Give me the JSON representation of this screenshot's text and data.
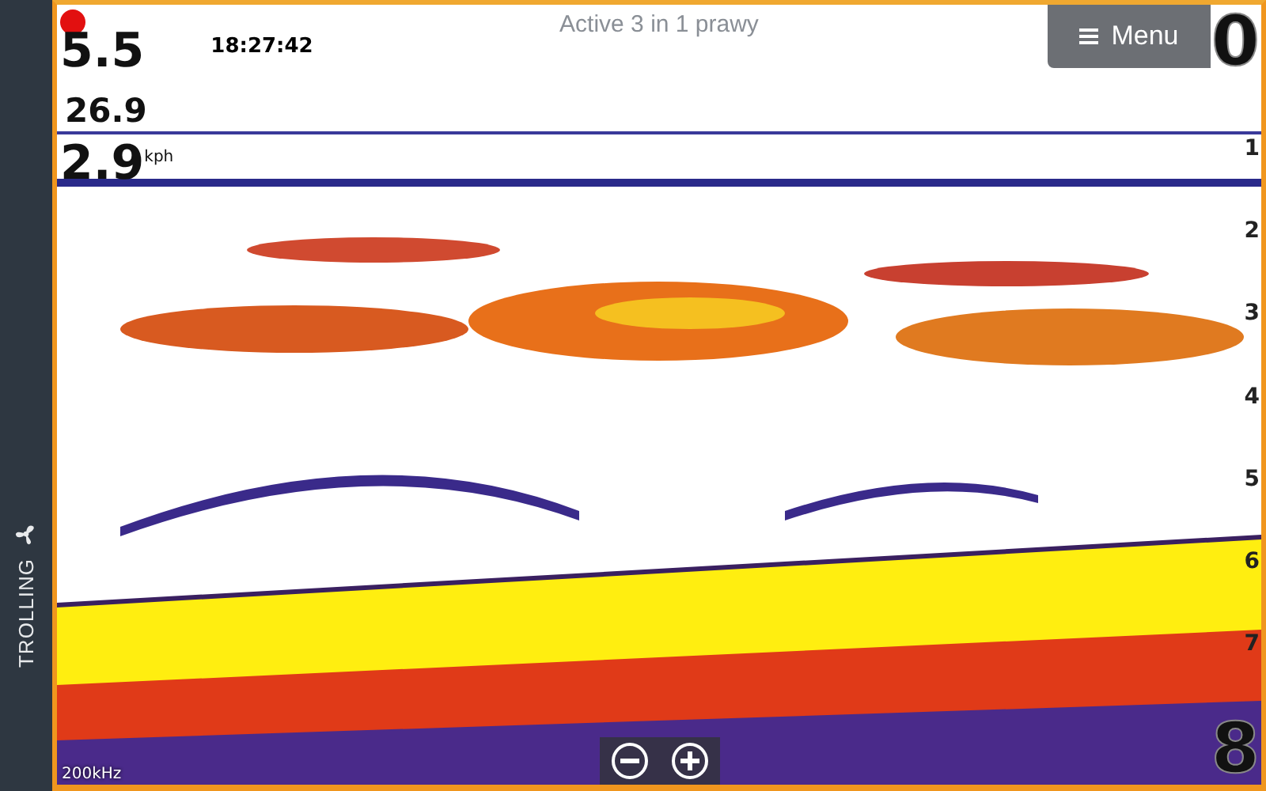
{
  "sidebar": {
    "label": "TROLLING"
  },
  "title": "Active 3 in 1 prawy",
  "menu_button": {
    "label": "Menu"
  },
  "clock": "18:27:42",
  "readouts": [
    {
      "value": "5.5"
    },
    {
      "value": "26.9"
    },
    {
      "value": "2.9",
      "unit": "kph"
    }
  ],
  "depth_scale": [
    {
      "label": "0",
      "kind": "major"
    },
    {
      "label": "1",
      "kind": "minor"
    },
    {
      "label": "2",
      "kind": "minor"
    },
    {
      "label": "3",
      "kind": "minor"
    },
    {
      "label": "4",
      "kind": "minor"
    },
    {
      "label": "5",
      "kind": "minor"
    },
    {
      "label": "6",
      "kind": "minor"
    },
    {
      "label": "7",
      "kind": "minor"
    },
    {
      "label": "8",
      "kind": "major"
    }
  ],
  "frequency": "200kHz"
}
